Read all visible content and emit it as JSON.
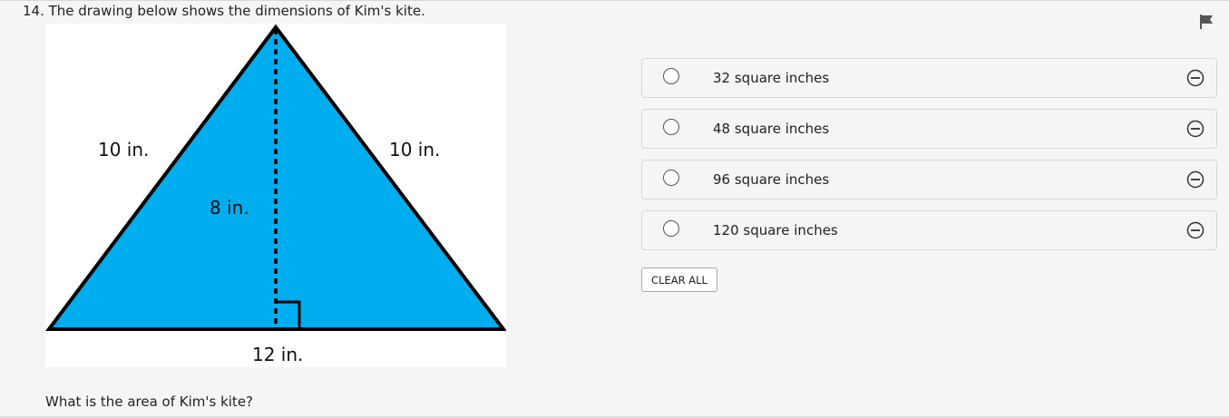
{
  "question": {
    "title": "14. The drawing below shows the dimensions of Kim's kite.",
    "prompt": "What is the area of Kim's kite?"
  },
  "figure": {
    "fill_color": "#00adef",
    "labels": {
      "left_side": "10 in.",
      "right_side": "10 in.",
      "height": "8 in.",
      "base": "12 in."
    }
  },
  "choices": [
    {
      "label": "32 square inches"
    },
    {
      "label": "48 square inches"
    },
    {
      "label": "96 square inches"
    },
    {
      "label": "120 square inches"
    }
  ],
  "actions": {
    "clear_all": "CLEAR ALL"
  },
  "icons": {
    "flag": "flag-icon",
    "eliminate": "eliminate-option-icon",
    "radio": "radio-button"
  }
}
